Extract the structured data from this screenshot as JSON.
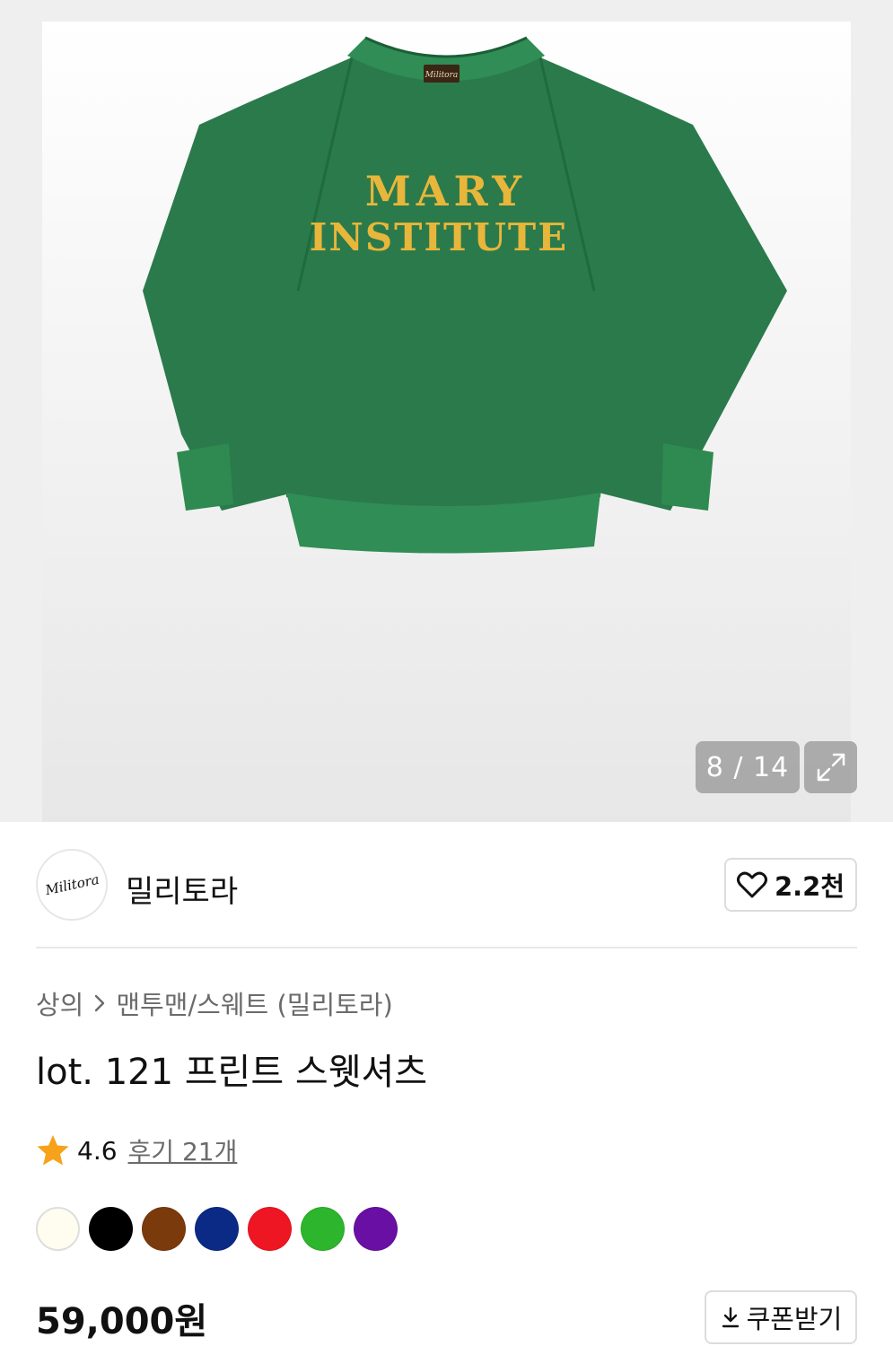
{
  "gallery": {
    "counter": "8 / 14",
    "shirt_print_line1": "MARY",
    "shirt_print_line2": "INSTITUTE",
    "label_text": "Militora",
    "shirt_color": "#2b7a4b",
    "print_color": "#e8b63a"
  },
  "brand": {
    "logo_text": "Militora",
    "name": "밀리토라",
    "likes": "2.2천"
  },
  "breadcrumb": {
    "category": "상의",
    "subcategory": "맨투맨/스웨트 (밀리토라)"
  },
  "product": {
    "title": "lot. 121 프린트 스웻셔츠",
    "rating": "4.6",
    "reviews": "후기 21개",
    "price": "59,000원",
    "coupon_label": "쿠폰받기"
  },
  "colors": [
    "#fffdf0",
    "#000000",
    "#7a3a0c",
    "#0a2a85",
    "#ee1622",
    "#2db52d",
    "#6a0fa3"
  ]
}
